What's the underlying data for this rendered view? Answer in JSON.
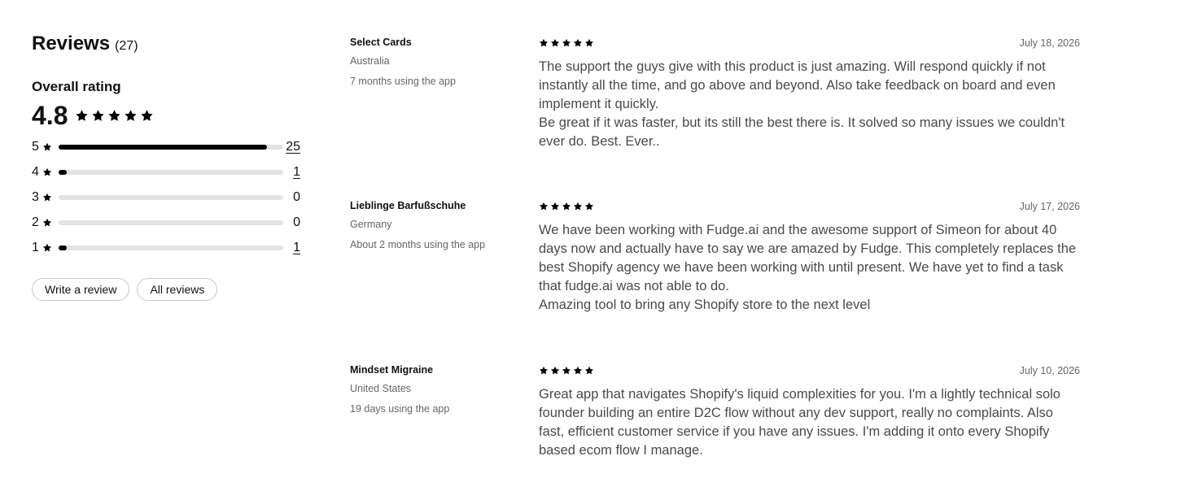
{
  "summary": {
    "title": "Reviews",
    "count": "(27)",
    "overall_label": "Overall rating",
    "overall_value": "4.8",
    "star_icon": "star-icon",
    "star_color": "#000000",
    "track_color": "#e3e3e3",
    "total_reviews": 27,
    "distribution": [
      {
        "stars": "5",
        "count": "25",
        "fraction": 0.926,
        "link": true
      },
      {
        "stars": "4",
        "count": "1",
        "fraction": 0.037,
        "link": true
      },
      {
        "stars": "3",
        "count": "0",
        "fraction": 0,
        "link": false
      },
      {
        "stars": "2",
        "count": "0",
        "fraction": 0,
        "link": false
      },
      {
        "stars": "1",
        "count": "1",
        "fraction": 0.037,
        "link": true
      }
    ]
  },
  "actions": {
    "write_review": "Write a review",
    "all_reviews": "All reviews"
  },
  "reviews": [
    {
      "store": "Select Cards",
      "country": "Australia",
      "usage": "7 months using the app",
      "date": "July 18, 2026",
      "rating": 5,
      "paragraphs": [
        "The support the guys give with this product is just amazing. Will respond quickly if not instantly all the time, and go above and beyond. Also take feedback on board and even implement it quickly.",
        "Be great if it was faster, but its still the best there is. It solved so many issues we couldn't ever do. Best. Ever.."
      ]
    },
    {
      "store": "Lieblinge Barfußschuhe",
      "country": "Germany",
      "usage": "About 2 months using the app",
      "date": "July 17, 2026",
      "rating": 5,
      "paragraphs": [
        "We have been working with Fudge.ai and the awesome support of Simeon for about 40 days now and actually have to say we are amazed by Fudge. This completely replaces the best Shopify agency we have been working with until present. We have yet to find a task that fudge.ai was not able to do.",
        "Amazing tool to bring any Shopify store to the next level"
      ]
    },
    {
      "store": "Mindset Migraine",
      "country": "United States",
      "usage": "19 days using the app",
      "date": "July 10, 2026",
      "rating": 5,
      "paragraphs": [
        "Great app that navigates Shopify's liquid complexities for you. I'm a lightly technical solo founder building an entire D2C flow without any dev support, really no complaints. Also fast, efficient customer service if you have any issues. I'm adding it onto every Shopify based ecom flow I manage."
      ]
    }
  ]
}
